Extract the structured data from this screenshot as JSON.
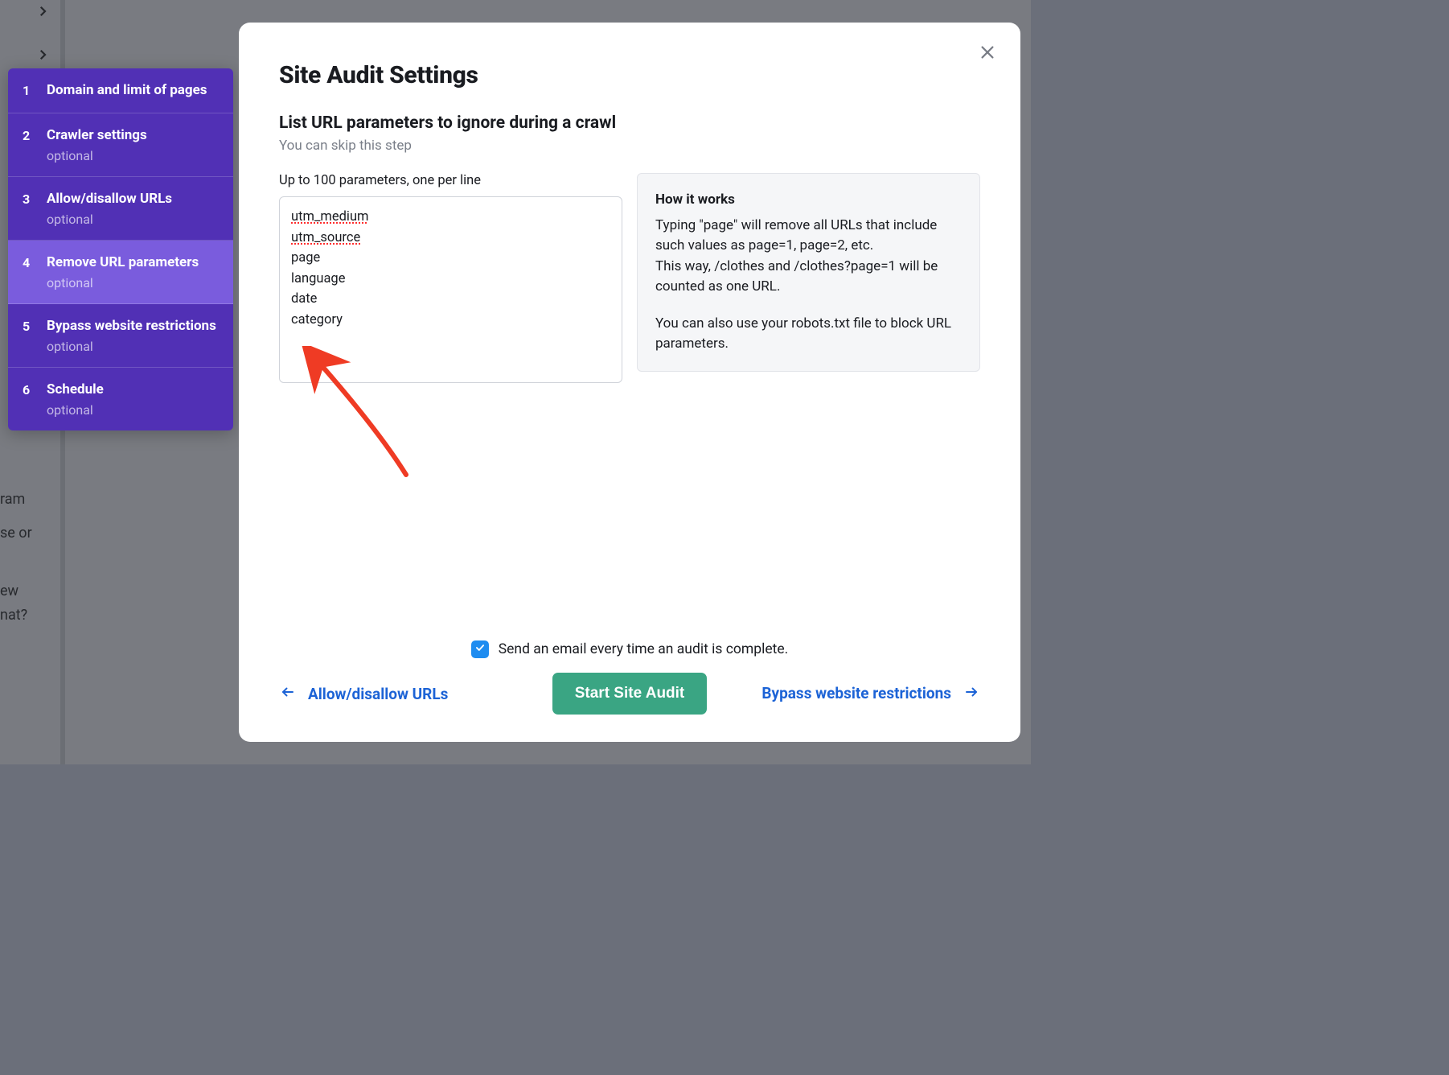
{
  "background": {
    "fragments": [
      "ram",
      "se or",
      "ew",
      "nat?"
    ]
  },
  "sidebar": {
    "steps": [
      {
        "num": "1",
        "title": "Domain and limit of pages",
        "optional": ""
      },
      {
        "num": "2",
        "title": "Crawler settings",
        "optional": "optional"
      },
      {
        "num": "3",
        "title": "Allow/disallow URLs",
        "optional": "optional"
      },
      {
        "num": "4",
        "title": "Remove URL parameters",
        "optional": "optional"
      },
      {
        "num": "5",
        "title": "Bypass website restrictions",
        "optional": "optional"
      },
      {
        "num": "6",
        "title": "Schedule",
        "optional": "optional"
      }
    ]
  },
  "modal": {
    "heading": "Site Audit Settings",
    "subheading": "List URL parameters to ignore during a crawl",
    "subtitle": "You can skip this step",
    "field_label": "Up to 100 parameters, one per line",
    "textarea_value": "utm_medium\nutm_source\npage\nlanguage\ndate\ncategory",
    "how_it_works": {
      "title": "How it works",
      "para1": "Typing \"page\" will remove all URLs that include such values as page=1, page=2, etc.",
      "para2": "This way, /clothes and /clothes?page=1 will be counted as one URL.",
      "para3": "You can also use your robots.txt file to block URL parameters."
    },
    "email_checkbox_label": "Send an email every time an audit is complete.",
    "prev_label": "Allow/disallow URLs",
    "next_label": "Bypass website restrictions",
    "start_label": "Start Site Audit"
  }
}
